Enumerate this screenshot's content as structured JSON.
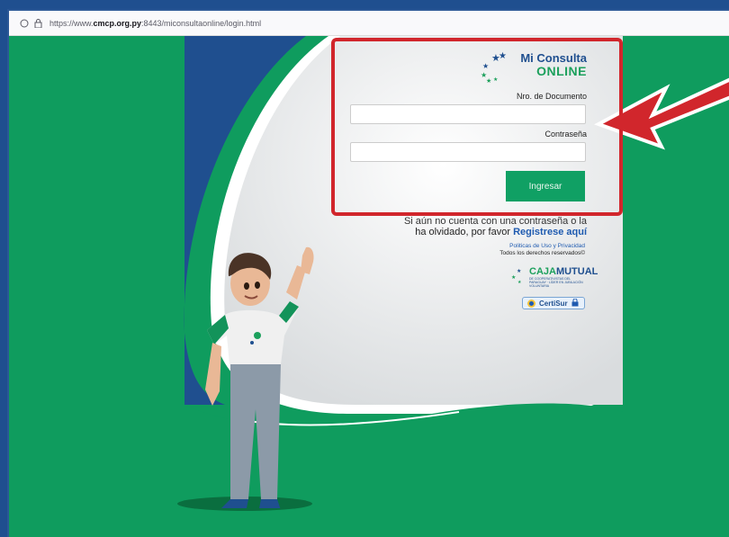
{
  "browser": {
    "url_prefix": "https://www.",
    "url_domain": "cmcp.org.py",
    "url_rest": ":8443/miconsultaonline/login.html"
  },
  "logo": {
    "line1": "Mi Consulta",
    "line2": "ONLINE"
  },
  "form": {
    "document_label": "Nro. de Documento",
    "document_value": "",
    "password_label": "Contraseña",
    "password_value": "",
    "submit_label": "Ingresar"
  },
  "help": {
    "line1": "Si aún no cuenta con una contraseña o la",
    "line2": "ha olvidado, por favor ",
    "register_link": "Registrese aquí"
  },
  "footer": {
    "policy_link": "Politicas de Uso y Privacidad",
    "rights": "Todos los derechos reservados©",
    "caja_prefix": "CAJA",
    "caja_suffix": "MUTUAL",
    "caja_tagline": "DE COOPERATIVISTAS DEL PARAGUAY · LÍDER EN JUBILACIÓN VOLUNTARIA",
    "certisur": "CertiSur"
  },
  "colors": {
    "page_green": "#0f9c5e",
    "brand_blue": "#1f4f8f",
    "highlight_red": "#d1262c"
  }
}
